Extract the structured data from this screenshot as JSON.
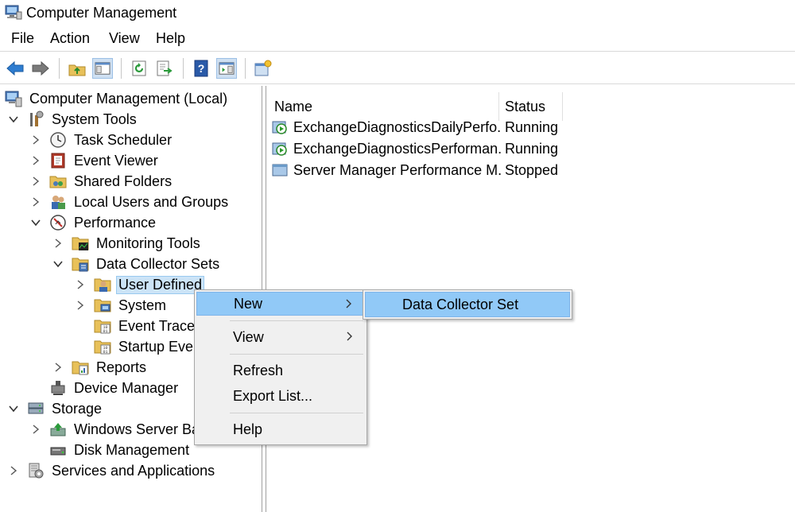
{
  "window": {
    "title": "Computer Management",
    "app_icon": "computer-management-icon"
  },
  "menubar": [
    "File",
    "Action",
    "View",
    "Help"
  ],
  "toolbar": {
    "buttons": [
      {
        "name": "back-arrow-icon"
      },
      {
        "name": "forward-arrow-icon"
      },
      {
        "name": "up-folder-icon"
      },
      {
        "name": "show-hide-console-tree-icon"
      },
      {
        "name": "refresh-icon"
      },
      {
        "name": "export-list-icon"
      },
      {
        "name": "help-icon"
      },
      {
        "name": "show-hide-action-pane-icon"
      },
      {
        "name": "properties-icon"
      }
    ]
  },
  "tree": {
    "nodes": [
      {
        "label": "Computer Management (Local)",
        "icon": "computer-management-icon",
        "expander": "none"
      },
      {
        "label": "System Tools",
        "icon": "system-tools-icon",
        "expander": "expanded"
      },
      {
        "label": "Task Scheduler",
        "icon": "clock-icon",
        "expander": "collapsed"
      },
      {
        "label": "Event Viewer",
        "icon": "event-viewer-icon",
        "expander": "collapsed"
      },
      {
        "label": "Shared Folders",
        "icon": "shared-folders-icon",
        "expander": "collapsed"
      },
      {
        "label": "Local Users and Groups",
        "icon": "users-icon",
        "expander": "collapsed"
      },
      {
        "label": "Performance",
        "icon": "performance-icon",
        "expander": "expanded"
      },
      {
        "label": "Monitoring Tools",
        "icon": "monitoring-folder-icon",
        "expander": "collapsed"
      },
      {
        "label": "Data Collector Sets",
        "icon": "data-collector-folder-icon",
        "expander": "expanded"
      },
      {
        "label": "User Defined",
        "icon": "user-defined-folder-icon",
        "expander": "collapsed"
      },
      {
        "label": "System",
        "icon": "system-folder-icon",
        "expander": "collapsed"
      },
      {
        "label": "Event Trace S",
        "icon": "binary-folder-icon",
        "expander": "none"
      },
      {
        "label": "Startup Even",
        "icon": "binary-folder-icon",
        "expander": "none"
      },
      {
        "label": "Reports",
        "icon": "reports-folder-icon",
        "expander": "collapsed"
      },
      {
        "label": "Device Manager",
        "icon": "device-manager-icon",
        "expander": "none"
      },
      {
        "label": "Storage",
        "icon": "storage-icon",
        "expander": "expanded"
      },
      {
        "label": "Windows Server Bac",
        "icon": "backup-icon",
        "expander": "collapsed"
      },
      {
        "label": "Disk Management",
        "icon": "disk-icon",
        "expander": "none"
      },
      {
        "label": "Services and Applications",
        "icon": "services-icon",
        "expander": "collapsed"
      }
    ]
  },
  "list": {
    "columns": [
      "Name",
      "Status"
    ],
    "rows": [
      {
        "name": "ExchangeDiagnosticsDailyPerfo...",
        "status": "Running",
        "icon": "running-collector-icon"
      },
      {
        "name": "ExchangeDiagnosticsPerforman...",
        "status": "Running",
        "icon": "running-collector-icon"
      },
      {
        "name": "Server Manager Performance M...",
        "status": "Stopped",
        "icon": "stopped-collector-icon"
      }
    ]
  },
  "context_menu": {
    "items": [
      "New",
      "View",
      "Refresh",
      "Export List...",
      "Help"
    ],
    "highlight_color": "#91c9f7"
  },
  "submenu": {
    "items": [
      "Data Collector Set"
    ]
  }
}
